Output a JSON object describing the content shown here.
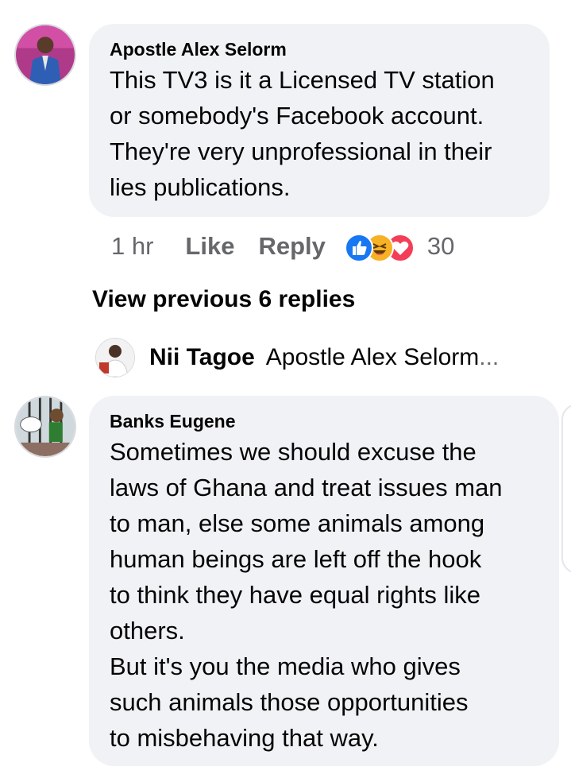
{
  "comments": [
    {
      "author": "Apostle Alex Selorm",
      "text": "This TV3 is it a Licensed TV station\nor somebody's Facebook account.\nThey're very unprofessional in their\nlies publications.",
      "time": "1 hr",
      "like_label": "Like",
      "reply_label": "Reply",
      "reaction_icons": [
        "like-icon",
        "haha-icon",
        "love-icon"
      ],
      "reaction_count": "30",
      "colors": {
        "like": "#1877f2",
        "haha": "#f7b125",
        "love": "#f33e58"
      }
    },
    {
      "author": "Banks Eugene",
      "text": "Sometimes we should excuse the\nlaws of Ghana and treat issues man\nto man, else some animals among\nhuman beings  are left off the hook\nto think they have equal rights like\nothers.\nBut it's you the media who gives\nsuch animals those opportunities\nto misbehaving that way."
    }
  ],
  "view_previous": "View previous 6 replies",
  "reply_preview": {
    "name": "Nii Tagoe",
    "text": "Apostle Alex Selorm",
    "ellipsis": "..."
  },
  "theme": {
    "bubble": "#f0f2f5",
    "meta_text": "#65676b",
    "text": "#050505"
  }
}
